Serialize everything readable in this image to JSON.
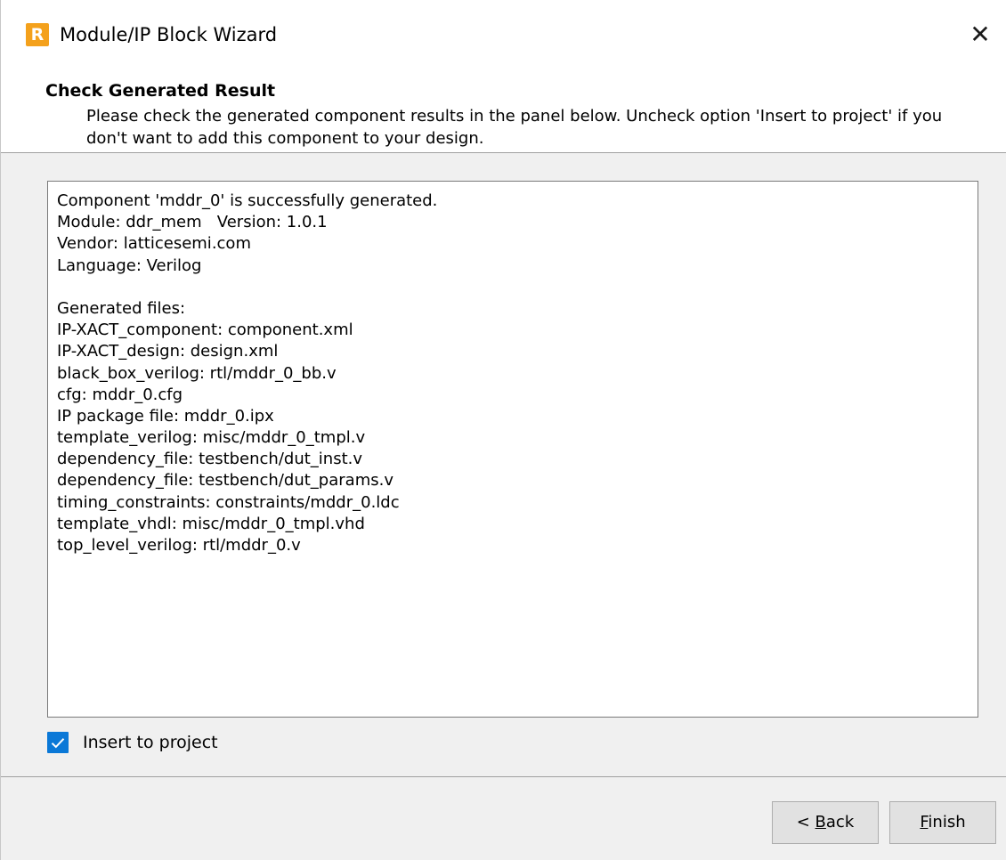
{
  "window": {
    "title": "Module/IP Block Wizard",
    "app_icon_letter": "R",
    "close_glyph": "✕"
  },
  "header": {
    "title": "Check Generated Result",
    "description": "Please check the generated component results in the panel below. Uncheck option 'Insert to project' if you don't want to add this component to your design."
  },
  "results": {
    "lines": [
      "Component 'mddr_0' is successfully generated.",
      "Module: ddr_mem   Version: 1.0.1",
      "Vendor: latticesemi.com",
      "Language: Verilog",
      "",
      "Generated files:",
      "IP-XACT_component: component.xml",
      "IP-XACT_design: design.xml",
      "black_box_verilog: rtl/mddr_0_bb.v",
      "cfg: mddr_0.cfg",
      "IP package file: mddr_0.ipx",
      "template_verilog: misc/mddr_0_tmpl.v",
      "dependency_file: testbench/dut_inst.v",
      "dependency_file: testbench/dut_params.v",
      "timing_constraints: constraints/mddr_0.ldc",
      "template_vhdl: misc/mddr_0_tmpl.vhd",
      "top_level_verilog: rtl/mddr_0.v"
    ]
  },
  "insert_option": {
    "label": "Insert to project",
    "checked": true
  },
  "buttons": {
    "back": {
      "prefix": "< ",
      "mnemonic": "B",
      "rest": "ack"
    },
    "finish": {
      "mnemonic": "F",
      "rest": "inish"
    }
  },
  "colors": {
    "accent": "#0a78d7",
    "app_icon": "#f4a11c",
    "dialog_bg": "#f0f0f0"
  }
}
